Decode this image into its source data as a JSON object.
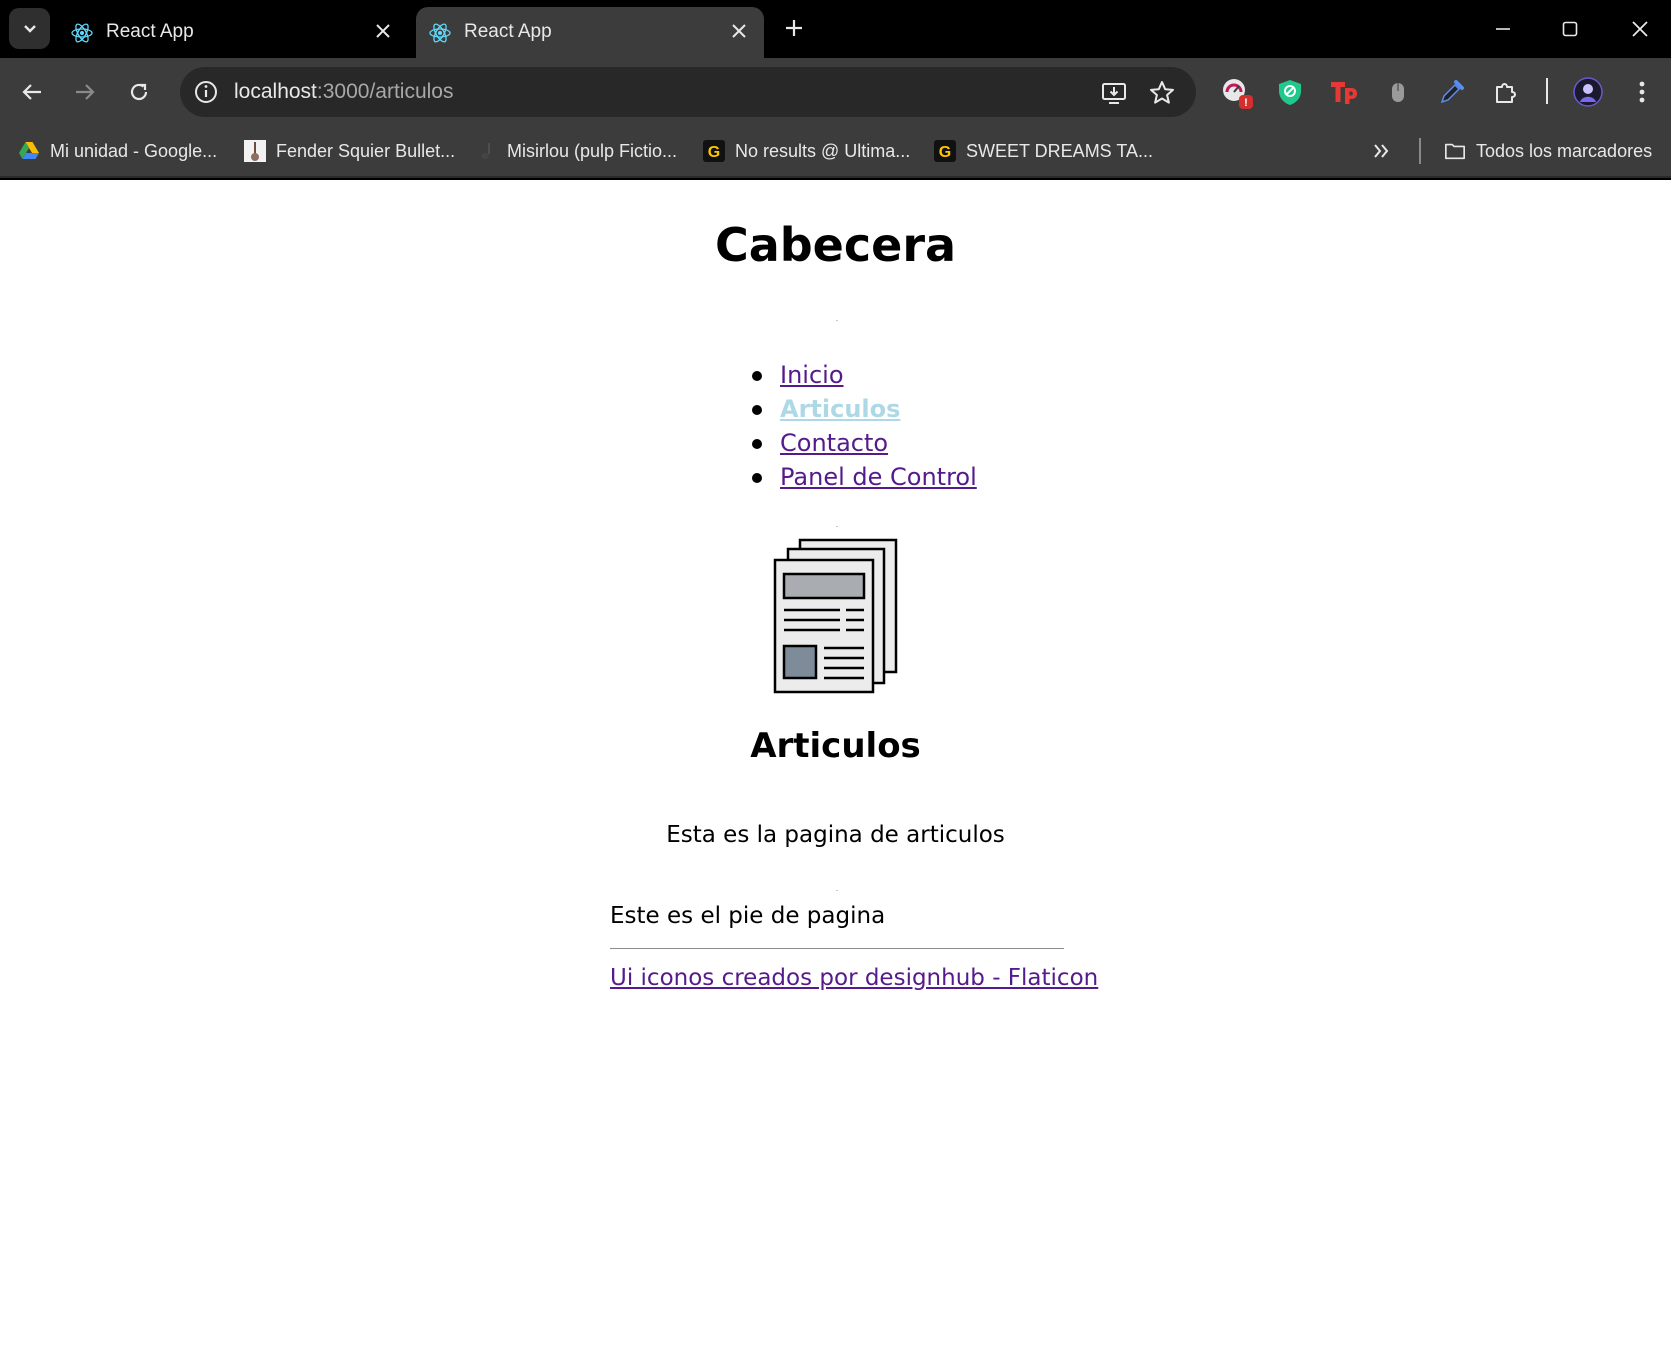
{
  "browser": {
    "tabs": [
      {
        "title": "React App",
        "active": false
      },
      {
        "title": "React App",
        "active": true
      }
    ],
    "address": {
      "host": "localhost",
      "rest": ":3000/articulos"
    },
    "bookmarks": [
      {
        "label": "Mi unidad - Google..."
      },
      {
        "label": "Fender Squier Bullet..."
      },
      {
        "label": "Misirlou (pulp Fictio..."
      },
      {
        "label": "No results @ Ultima..."
      },
      {
        "label": "SWEET DREAMS TA..."
      }
    ],
    "all_bookmarks_label": "Todos los marcadores",
    "extension_badge": "!"
  },
  "page": {
    "header_title": "Cabecera",
    "nav": [
      {
        "label": "Inicio",
        "active": false
      },
      {
        "label": "Articulos",
        "active": true
      },
      {
        "label": "Contacto",
        "active": false
      },
      {
        "label": "Panel de Control",
        "active": false
      }
    ],
    "article_title": "Articulos",
    "article_description": "Esta es la pagina de articulos",
    "footer_text": "Este es el pie de pagina",
    "footer_link": "Ui iconos creados por designhub - Flaticon"
  },
  "colors": {
    "chrome_bg": "#000000",
    "toolbar_bg": "#3c3c3c",
    "link_visited": "#551a8b",
    "link_active": "#add8e6"
  }
}
